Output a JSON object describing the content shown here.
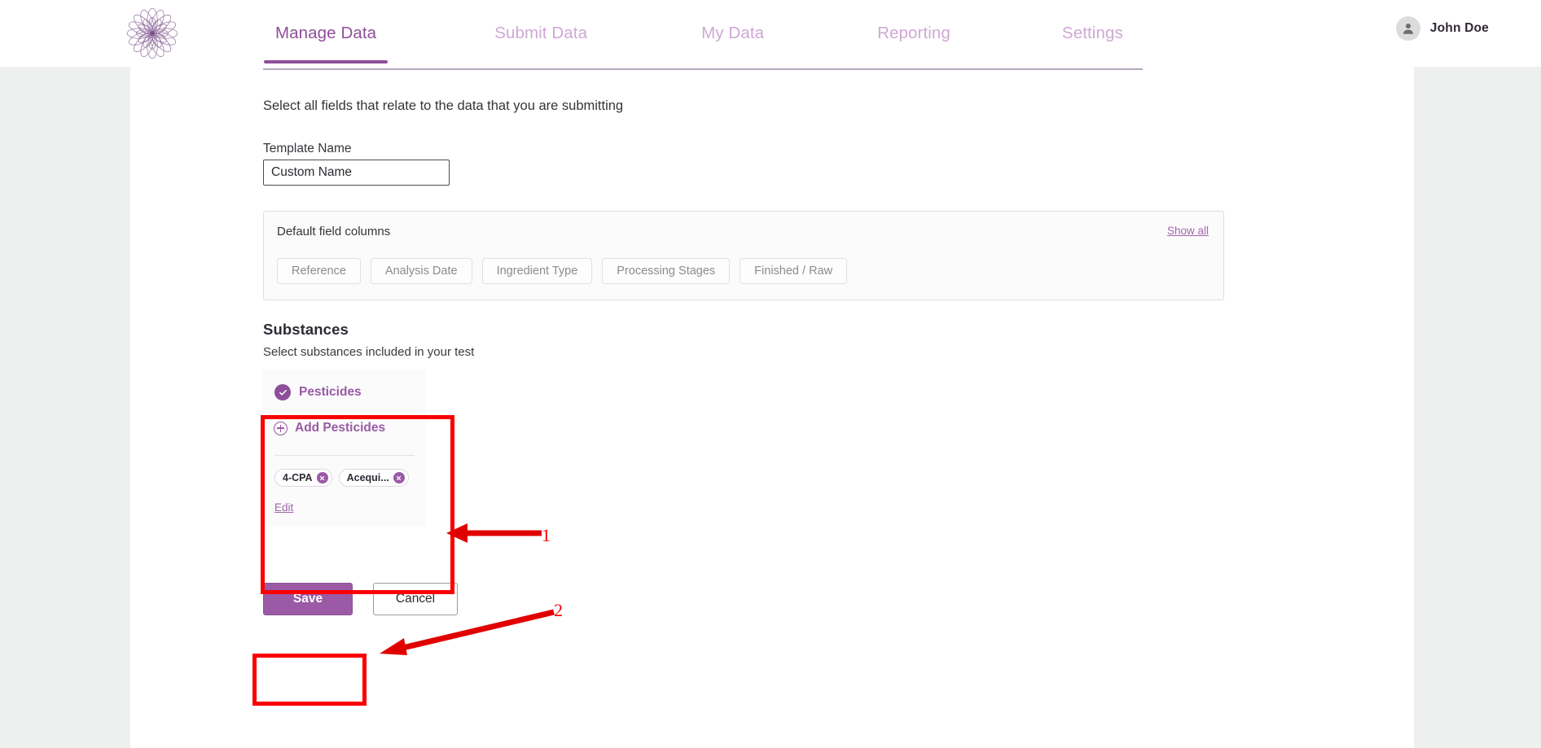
{
  "nav": {
    "logo_icon": "flower-mandala-logo",
    "items": [
      {
        "label": "Manage Data",
        "active": true
      },
      {
        "label": "Submit Data",
        "active": false
      },
      {
        "label": "My Data",
        "active": false
      },
      {
        "label": "Reporting",
        "active": false
      },
      {
        "label": "Settings",
        "active": false
      }
    ],
    "user": {
      "name": "John Doe",
      "avatar_icon": "user-avatar-icon"
    }
  },
  "form": {
    "subtitle": "Select all fields that relate to the data that you are submitting",
    "template_name_label": "Template Name",
    "template_name_value": "Custom Name",
    "template_name_placeholder": "Custom Name"
  },
  "default_fields": {
    "title": "Default field columns",
    "show_all_label": "Show all",
    "pills": [
      "Reference",
      "Analysis Date",
      "Ingredient Type",
      "Processing Stages",
      "Finished / Raw"
    ]
  },
  "substances": {
    "title": "Substances",
    "subtitle": "Select substances included in your test",
    "category": {
      "label": "Pesticides",
      "checked": true,
      "check_icon": "check-circle-icon"
    },
    "add_label": "Add Pesticides",
    "add_icon": "plus-circle-icon",
    "chips": [
      {
        "label": "4-CPA",
        "remove_icon": "close-circle-icon"
      },
      {
        "label": "Acequi...",
        "remove_icon": "close-circle-icon"
      }
    ],
    "edit_label": "Edit"
  },
  "actions": {
    "save_label": "Save",
    "cancel_label": "Cancel"
  },
  "annotations": {
    "marker_1": "1",
    "marker_2": "2",
    "color": "#fb0000"
  },
  "colors": {
    "brand_purple": "#8e4e99",
    "brand_purple_light": "#cfa8d4",
    "accent_purple": "#9a5aa5",
    "page_background": "#eef0ef",
    "card_background": "#ffffff"
  }
}
